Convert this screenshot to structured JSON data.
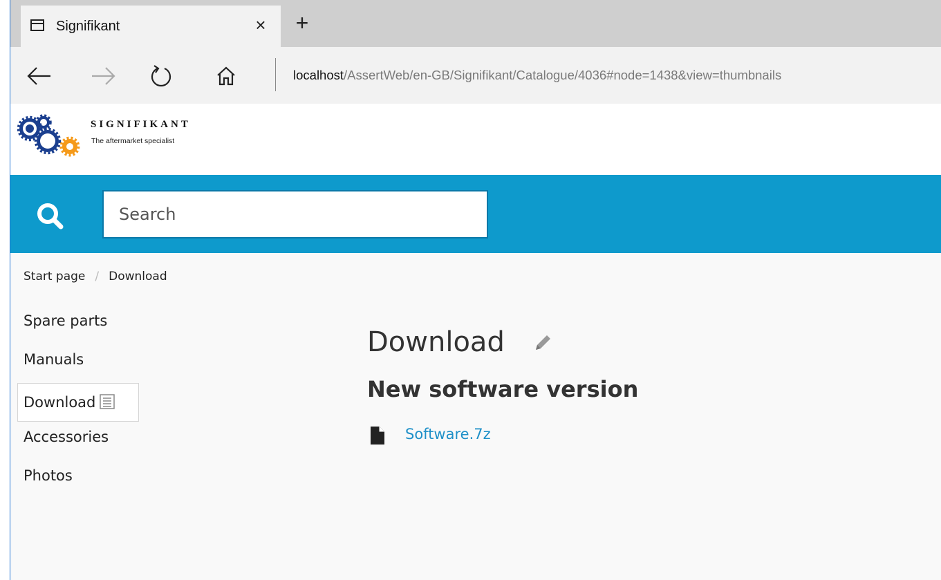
{
  "browser": {
    "tab": {
      "title": "Signifikant",
      "close_label": "×"
    },
    "new_tab_label": "+",
    "address": {
      "host": "localhost",
      "path": "/AssertWeb/en-GB/Signifikant/Catalogue/4036#node=1438&view=thumbnails"
    }
  },
  "site": {
    "brand_name": "SIGNIFIKANT",
    "tagline": "The aftermarket specialist",
    "colors": {
      "accent": "#0e9acc",
      "link": "#1e90c8",
      "gear_blue": "#1b3f8f",
      "gear_orange": "#f59a1a"
    }
  },
  "search": {
    "placeholder": "Search"
  },
  "breadcrumb": {
    "items": [
      "Start page",
      "Download"
    ],
    "separator": "/"
  },
  "sidemenu": {
    "items": [
      {
        "label": "Spare parts"
      },
      {
        "label": "Manuals"
      },
      {
        "label": "Download",
        "active": true
      },
      {
        "label": "Accessories"
      },
      {
        "label": "Photos"
      }
    ]
  },
  "main": {
    "title": "Download",
    "section_title": "New software version",
    "files": [
      {
        "name": "Software.7z",
        "icon": "file-icon"
      }
    ]
  }
}
